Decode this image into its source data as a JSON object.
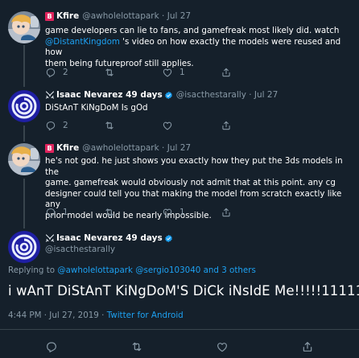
{
  "tweets": [
    {
      "badge": "B",
      "name": "Kfire",
      "handle": "@awholelottapark · Jul 27",
      "text_a": "game developers can lie to fans, and gamefreak most likely did. watch",
      "mention": "@DistantKingdom",
      "text_b": " 's video on how exactly the models were reused and how",
      "text_c": "them being futureproof still applies.",
      "replies": "2",
      "retweets": "",
      "likes": "1",
      "avatar": "anime-avatar"
    },
    {
      "name": "Isaac Nevarez 49 days",
      "handle": "@isacthestarally · Jul 27",
      "text": "DiStAnT KiNgDoM Is gOd",
      "replies": "2",
      "retweets": "",
      "likes": "",
      "avatar": "swirl-logo-avatar"
    },
    {
      "badge": "B",
      "name": "Kfire",
      "handle": "@awholelottapark · Jul 27",
      "lines": [
        "he's not god. he just shows you exactly how they put the 3ds models in the",
        "game. gamefreak would obviously not admit that at this point.  any cg",
        "designer could tell you that making the model from scratch exactly like any",
        "prior model would be nearly impossible."
      ],
      "replies": "1",
      "retweets": "",
      "likes": "1",
      "avatar": "anime-avatar"
    }
  ],
  "main_tweet": {
    "name": "Isaac Nevarez 49 days",
    "handle": "@isacthestarally",
    "reply_prefix": "Replying to ",
    "reply_targets": "@awholelottapark @sergio103040 and 3 others",
    "text": "i wAnT DiStAnT KiNgDoM'S DiCk iNsIdE Me!!!!!11111",
    "timestamp": "4:44 PM · Jul 27, 2019 · ",
    "client": "Twitter for Android"
  },
  "colors": {
    "background": "#15202b",
    "link": "#1da1f2",
    "muted": "#8899a6",
    "divider": "#38444d",
    "badge": "#e0245e"
  },
  "icons": [
    "reply-icon",
    "retweet-icon",
    "like-icon",
    "share-icon",
    "verified-icon",
    "crossed-swords-icon"
  ]
}
